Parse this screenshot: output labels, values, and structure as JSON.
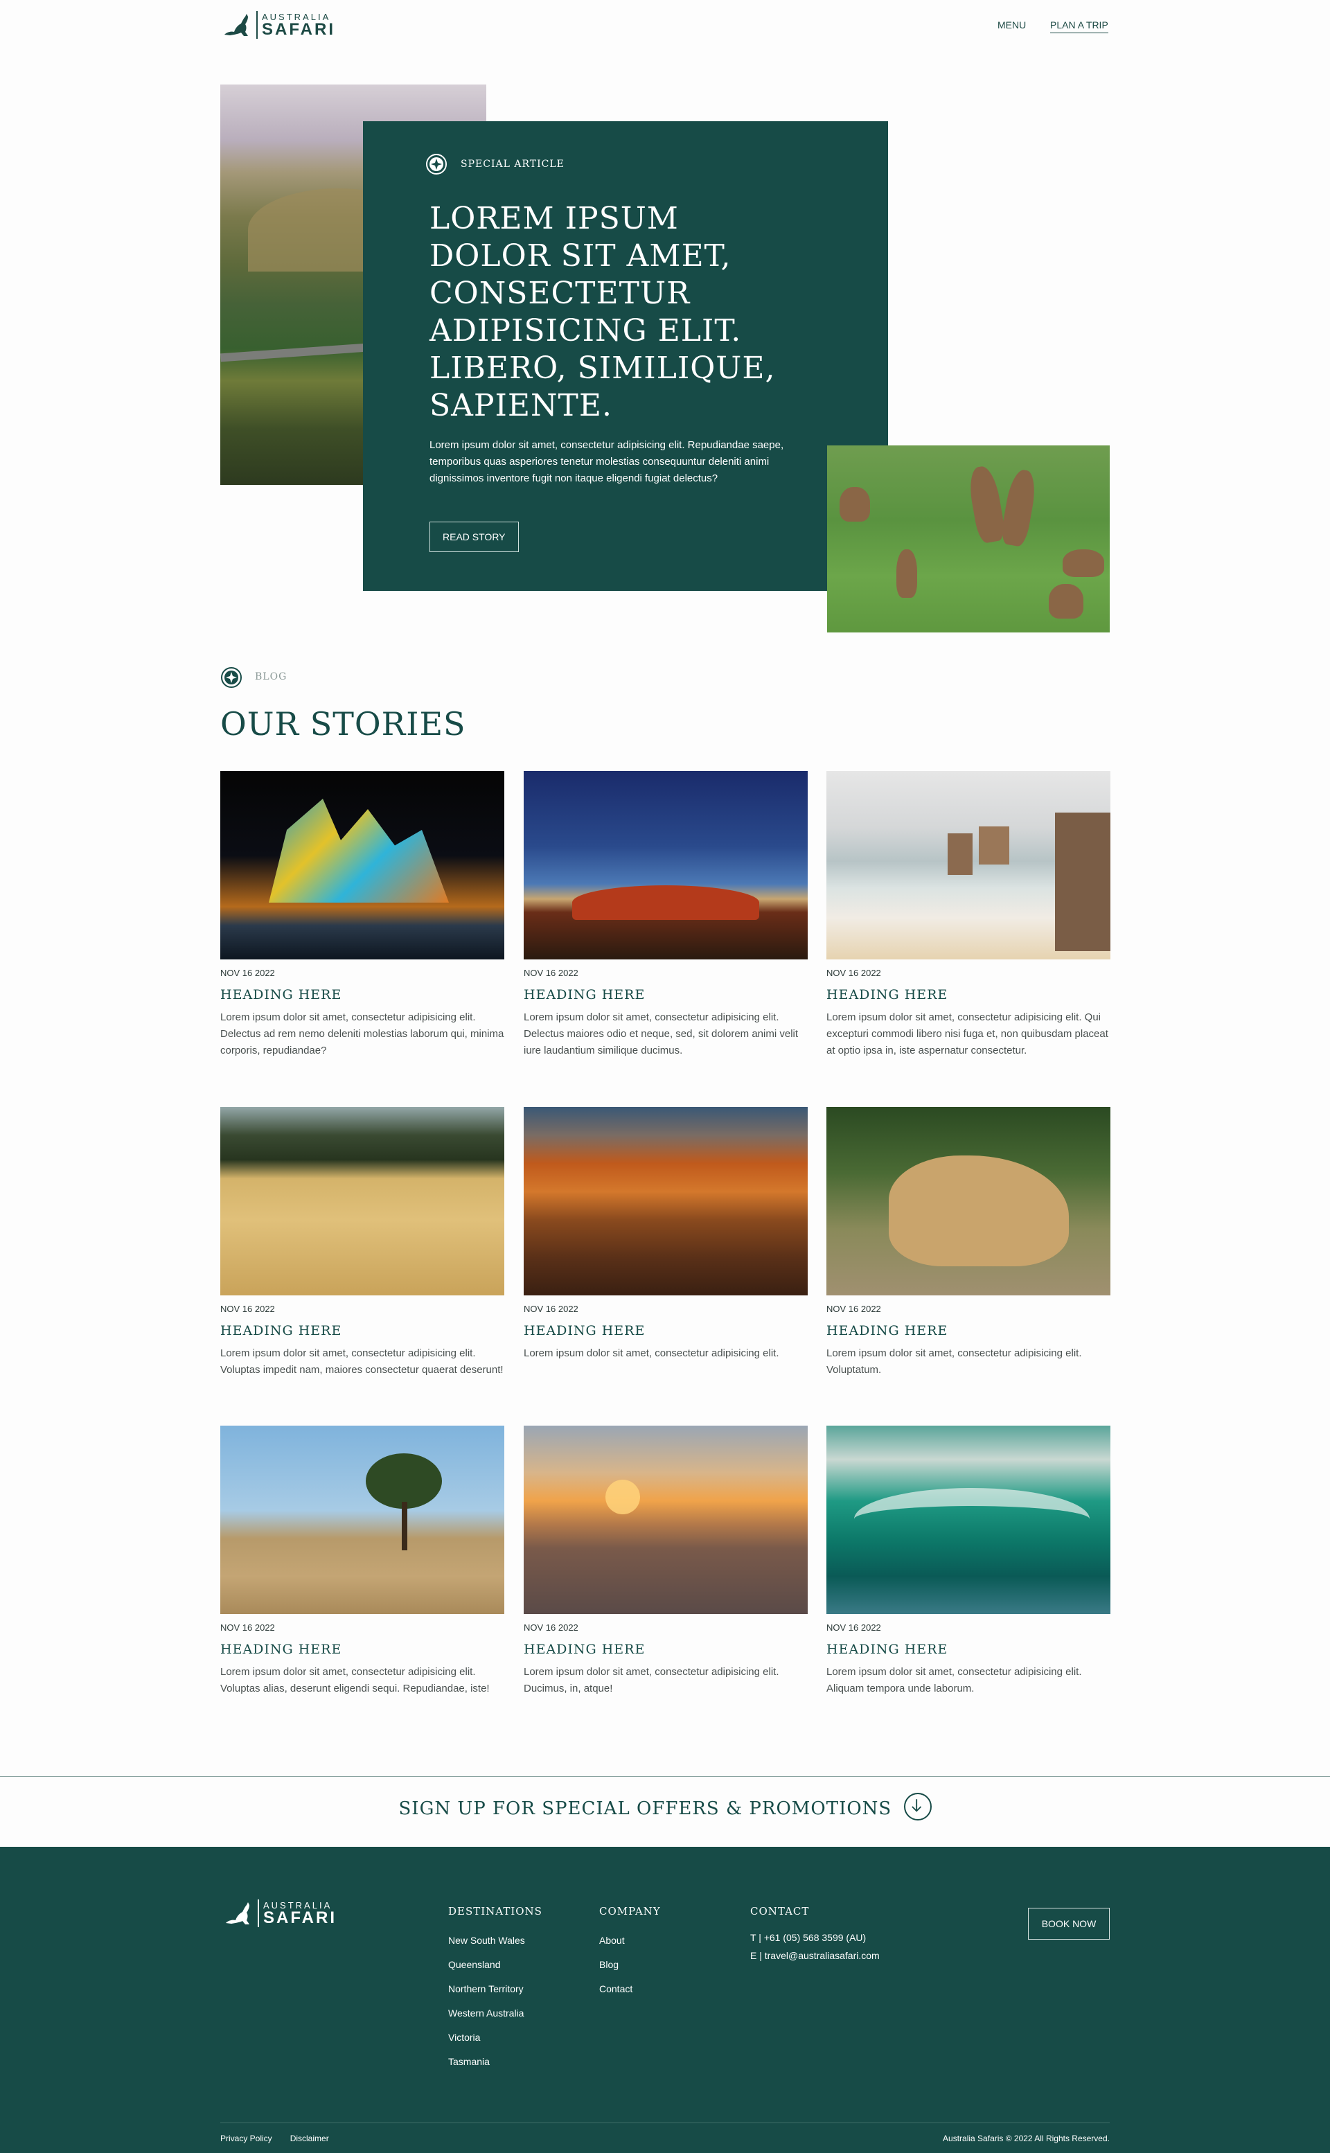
{
  "brand": {
    "line1": "AUSTRALIA",
    "line2": "SAFARI"
  },
  "nav": {
    "menu": "MENU",
    "plan_trip": "PLAN A TRIP"
  },
  "hero": {
    "eyebrow": "SPECIAL ARTICLE",
    "title": "LOREM IPSUM DOLOR SIT AMET, CONSECTETUR ADIPISICING ELIT. LIBERO, SIMILIQUE, SAPIENTE.",
    "body": "Lorem ipsum dolor sit amet, consectetur adipisicing elit. Repudiandae saepe, temporibus quas asperiores tenetur molestias consequuntur deleniti animi dignissimos inventore fugit non itaque eligendi fugiat delectus?",
    "cta": "READ STORY"
  },
  "blog": {
    "label": "BLOG",
    "title": "OUR STORIES",
    "cards": [
      {
        "image": "sydney-opera-house-lit",
        "date": "NOV 16 2022",
        "heading": "HEADING HERE",
        "text": "Lorem ipsum dolor sit amet, consectetur adipisicing elit. Delectus ad rem nemo deleniti molestias laborum qui, minima corporis, repudiandae?"
      },
      {
        "image": "uluru-dusk",
        "date": "NOV 16 2022",
        "heading": "HEADING HERE",
        "text": "Lorem ipsum dolor sit amet, consectetur adipisicing elit. Delectus maiores odio et neque, sed, sit dolorem animi velit iure laudantium similique ducimus."
      },
      {
        "image": "twelve-apostles-coast",
        "date": "NOV 16 2022",
        "heading": "HEADING HERE",
        "text": "Lorem ipsum dolor sit amet, consectetur adipisicing elit. Qui excepturi commodi libero nisi fuga et, non quibusdam placeat at optio ipsa in, iste aspernatur consectetur."
      },
      {
        "image": "emus-in-grassland",
        "date": "NOV 16 2022",
        "heading": "HEADING HERE",
        "text": "Lorem ipsum dolor sit amet, consectetur adipisicing elit. Voluptas impedit nam, maiores consectetur quaerat deserunt!"
      },
      {
        "image": "red-gorge-cliffs",
        "date": "NOV 16 2022",
        "heading": "HEADING HERE",
        "text": "Lorem ipsum dolor sit amet, consectetur adipisicing elit."
      },
      {
        "image": "lioness-resting",
        "date": "NOV 16 2022",
        "heading": "HEADING HERE",
        "text": "Lorem ipsum dolor sit amet, consectetur adipisicing elit. Voluptatum."
      },
      {
        "image": "savanna-tree",
        "date": "NOV 16 2022",
        "heading": "HEADING HERE",
        "text": "Lorem ipsum dolor sit amet, consectetur adipisicing elit. Voluptas alias, deserunt eligendi sequi. Repudiandae, iste!"
      },
      {
        "image": "sydney-harbour-sunset",
        "date": "NOV 16 2022",
        "heading": "HEADING HERE",
        "text": "Lorem ipsum dolor sit amet, consectetur adipisicing elit. Ducimus, in, atque!"
      },
      {
        "image": "surfer-barrel-wave",
        "date": "NOV 16 2022",
        "heading": "HEADING HERE",
        "text": "Lorem ipsum dolor sit amet, consectetur adipisicing elit. Aliquam tempora unde laborum."
      }
    ]
  },
  "signup": {
    "text": "SIGN UP FOR SPECIAL OFFERS & PROMOTIONS"
  },
  "footer": {
    "destinations": {
      "heading": "DESTINATIONS",
      "items": [
        "New South Wales",
        "Queensland",
        "Northern Territory",
        "Western Australia",
        "Victoria",
        "Tasmania"
      ]
    },
    "company": {
      "heading": "COMPANY",
      "items": [
        "About",
        "Blog",
        "Contact"
      ]
    },
    "contact": {
      "heading": "CONTACT",
      "phone": "T | +61 (05) 568 3599 (AU)",
      "email": "E | travel@australiasafari.com"
    },
    "book": "BOOK NOW",
    "privacy": "Privacy Policy",
    "disclaimer": "Disclaimer",
    "copyright": "Australia Safaris © 2022 All Rights Reserved."
  },
  "colors": {
    "brand_green": "#174b47",
    "background": "#fdfdfd"
  }
}
